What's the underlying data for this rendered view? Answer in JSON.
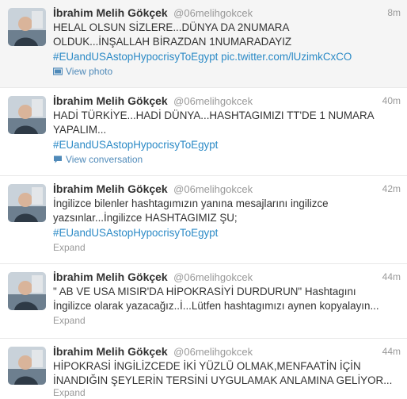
{
  "tweets": [
    {
      "fullname": "İbrahim Melih Gökçek",
      "username": "@06melihgokcek",
      "time": "8m",
      "lines": [
        "HELAL OLSUN SİZLERE...DÜNYA DA 2NUMARA",
        "OLDUK...İNŞALLAH BİRAZDAN 1NUMARADAYIZ"
      ],
      "hashtag": "#EUandUSAstopHypocrisyToEgypt",
      "link": "pic.twitter.com/lUzimkCxCO",
      "action": "View photo",
      "action_icon": "photo-icon"
    },
    {
      "fullname": "İbrahim Melih Gökçek",
      "username": "@06melihgokcek",
      "time": "40m",
      "lines": [
        "HADİ TÜRKİYE...HADİ DÜNYA...HASHTAGIMIZI TT'DE 1 NUMARA",
        "YAPALIM..."
      ],
      "hashtag": "#EUandUSAstopHypocrisyToEgypt",
      "action": "View conversation",
      "action_icon": "speech-bubble-icon"
    },
    {
      "fullname": "İbrahim Melih Gökçek",
      "username": "@06melihgokcek",
      "time": "42m",
      "lines": [
        "İngilizce bilenler hashtagımızın yanına mesajlarını ingilizce",
        "yazsınlar...İngilizce HASHTAGIMIZ ŞU;"
      ],
      "hashtag": "#EUandUSAstopHypocrisyToEgypt",
      "action": "Expand"
    },
    {
      "fullname": "İbrahim Melih Gökçek",
      "username": "@06melihgokcek",
      "time": "44m",
      "lines": [
        "\" AB VE USA MISIR'DA HİPOKRASİYİ DURDURUN\" Hashtagını",
        "İngilizce olarak yazacağız..İ...Lütfen hashtagımızı aynen kopyalayın..."
      ],
      "action": "Expand"
    },
    {
      "fullname": "İbrahim Melih Gökçek",
      "username": "@06melihgokcek",
      "time": "44m",
      "lines": [
        "HİPOKRASİ İNGİLİZCEDE İKİ YÜZLÜ OLMAK,MENFAATİN İÇİN",
        "İNANDIĞIN ŞEYLERİN TERSİNİ UYGULAMAK ANLAMINA GELİYOR..."
      ],
      "action": "Expand"
    }
  ]
}
